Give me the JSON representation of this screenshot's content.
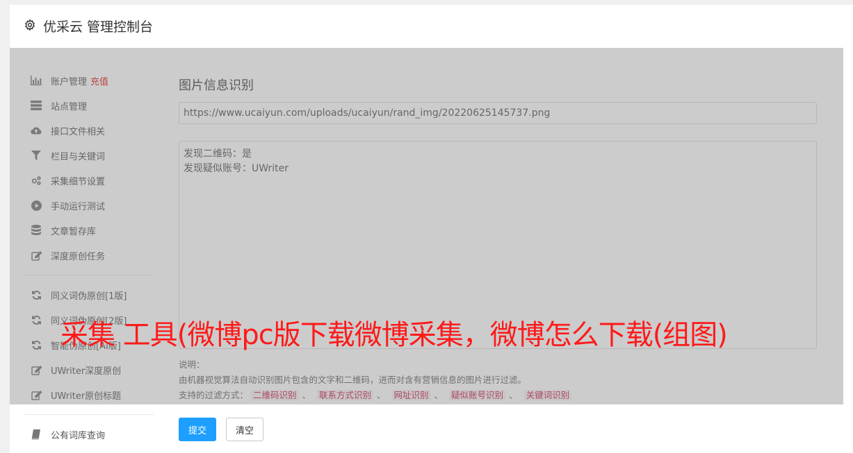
{
  "header": {
    "title": "优采云 管理控制台"
  },
  "sidebar": {
    "items": [
      {
        "label": "账户管理",
        "accent": "充值",
        "icon": "bar-chart-icon"
      },
      {
        "label": "站点管理",
        "icon": "server-icon"
      },
      {
        "label": "接口文件相关",
        "icon": "cloud-upload-icon"
      },
      {
        "label": "栏目与关键词",
        "icon": "filter-icon"
      },
      {
        "label": "采集细节设置",
        "icon": "cogs-icon"
      },
      {
        "label": "手动运行测试",
        "icon": "play-circle-icon"
      },
      {
        "label": "文章暂存库",
        "icon": "database-icon"
      },
      {
        "label": "深度原创任务",
        "icon": "edit-icon"
      }
    ],
    "items2": [
      {
        "label": "同义词伪原创[1版]",
        "icon": "refresh-icon"
      },
      {
        "label": "同义词伪原创[2版]",
        "icon": "refresh-icon"
      },
      {
        "label": "智能伪原创[AI版]",
        "icon": "refresh-icon"
      },
      {
        "label": "UWriter深度原创",
        "icon": "edit-icon"
      },
      {
        "label": "UWriter原创标题",
        "icon": "edit-icon"
      }
    ],
    "items3": [
      {
        "label": "公有词库查询",
        "icon": "book-icon"
      }
    ]
  },
  "main": {
    "title": "图片信息识别",
    "url_value": "https://www.ucaiyun.com/uploads/ucaiyun/rand_img/20220625145737.png",
    "result_lines": [
      "发现二维码：是",
      "发现疑似账号：UWriter"
    ],
    "note_label": "说明：",
    "note_desc": "由机器视觉算法自动识别图片包含的文字和二维码，进而对含有营销信息的图片进行过滤。",
    "filter_label": "支持的过滤方式：",
    "filters": [
      "二维码识别",
      "联系方式识别",
      "网址识别",
      "疑似账号识别",
      "关键词识别"
    ],
    "submit_label": "提交",
    "clear_label": "清空"
  },
  "watermark": "采集 工具(微博pc版下载微博采集，微博怎么下载(组图)",
  "colors": {
    "primary": "#1e9fff",
    "accent": "#e02020",
    "watermark": "#ff1a1a"
  }
}
